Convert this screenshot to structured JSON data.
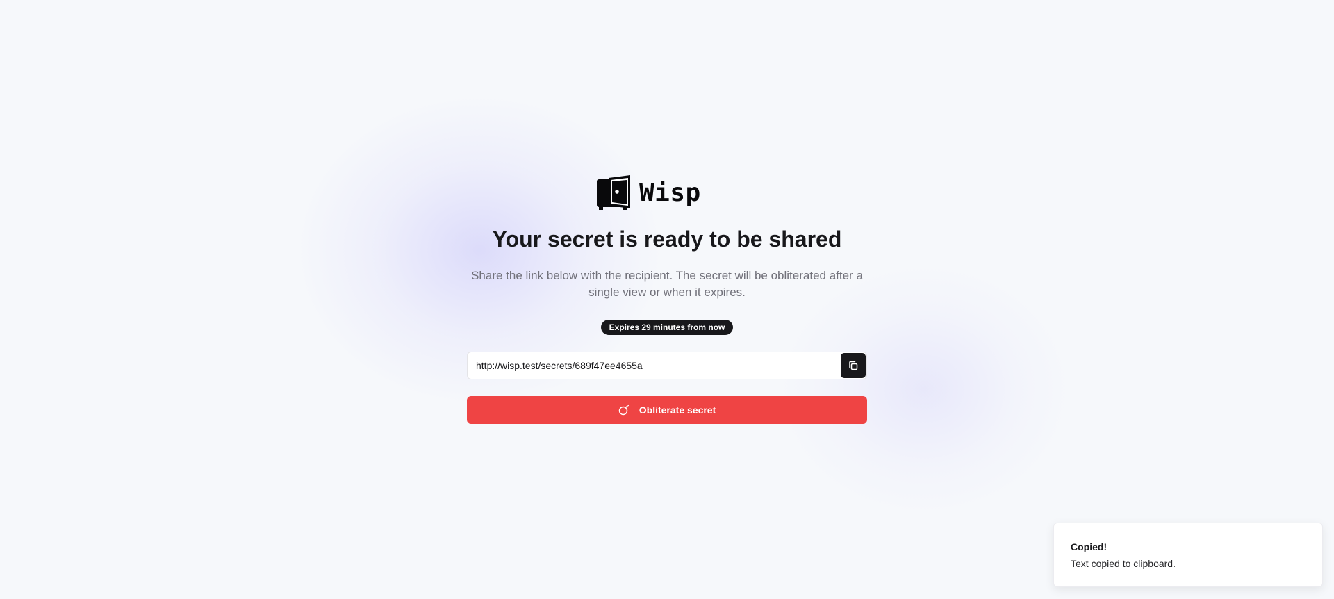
{
  "app": {
    "name": "Wisp",
    "logo_icon": "safe-door-icon"
  },
  "main": {
    "title": "Your secret is ready to be shared",
    "description": "Share the link below with the recipient. The secret will be obliterated after a single view or when it expires.",
    "expiry_badge": "Expires 29 minutes from now",
    "link": {
      "value": "http://wisp.test/secrets/689f47ee4655a",
      "copy_icon": "copy-icon"
    },
    "obliterate": {
      "label": "Obliterate secret",
      "icon": "bomb-icon"
    }
  },
  "toast": {
    "title": "Copied!",
    "message": "Text copied to clipboard."
  },
  "colors": {
    "danger": "#ef4444",
    "dark": "#18181b",
    "muted_text": "#71717a",
    "background": "#f6f8fb"
  }
}
